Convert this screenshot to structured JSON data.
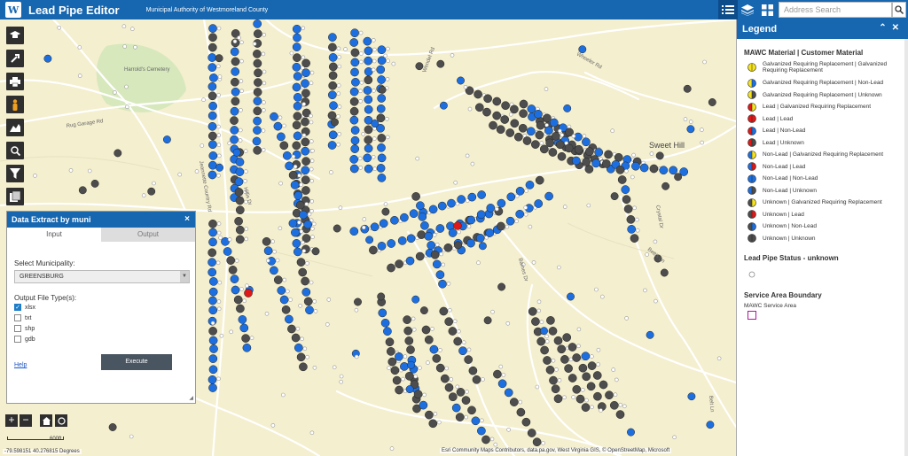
{
  "header": {
    "app_title": "Lead Pipe Editor",
    "org_name": "Municipal Authority of Westmoreland County",
    "logo_text": "W",
    "search_placeholder": "Address Search"
  },
  "map_labels": [
    {
      "text": "Harrold's Cemetery"
    },
    {
      "text": "Rug Garage Rd"
    },
    {
      "text": "Jeannette Country Rd"
    },
    {
      "text": "Hillis Dr"
    },
    {
      "text": "Wendel Rd"
    },
    {
      "text": "Guffey Rd"
    },
    {
      "text": "Wheeler Rd"
    },
    {
      "text": "Barnes Dr"
    },
    {
      "text": "Sweet Hill"
    },
    {
      "text": "Crystal Dr"
    },
    {
      "text": "Bettis Ln"
    },
    {
      "text": "Belt Ln"
    }
  ],
  "data_extract_panel": {
    "title": "Data Extract by muni",
    "close": "×",
    "tabs": [
      "Input",
      "Output"
    ],
    "select_label": "Select Municipality:",
    "selected_municipality": "GREENSBURG",
    "file_types_label": "Output File Type(s):",
    "file_types": [
      {
        "label": "xlsx",
        "checked": true
      },
      {
        "label": "txt",
        "checked": false
      },
      {
        "label": "shp",
        "checked": false
      },
      {
        "label": "gdb",
        "checked": false
      }
    ],
    "help_link": "Help",
    "execute_button": "Execute"
  },
  "map_controls": {
    "zoom_in": "+",
    "zoom_out": "−",
    "scale_label": "600ft",
    "coordinates": "-79.598151 40.276815 Degrees",
    "attribution": "Esri Community Maps Contributors, data.pa.gov, West Virginia GIS, © OpenStreetMap, Microsoft"
  },
  "legend": {
    "title": "Legend",
    "section1_title": "MAWC Material | Customer Material",
    "items": [
      {
        "label": "Galvanized Requiring Replacement | Galvanized Requiring Replacement",
        "left": "#f5e21a",
        "right": "#f5e21a"
      },
      {
        "label": "Galvanized Requiring Replacement | Non-Lead",
        "left": "#f5e21a",
        "right": "#1d6fe0"
      },
      {
        "label": "Galvanized Requiring Replacement | Unknown",
        "left": "#f5e21a",
        "right": "#4d4d4d"
      },
      {
        "label": "Lead | Galvanized Requiring Replacement",
        "left": "#e01818",
        "right": "#f5e21a"
      },
      {
        "label": "Lead | Lead",
        "left": "#e01818",
        "right": "#e01818"
      },
      {
        "label": "Lead | Non-Lead",
        "left": "#e01818",
        "right": "#1d6fe0"
      },
      {
        "label": "Lead | Unknown",
        "left": "#e01818",
        "right": "#4d4d4d"
      },
      {
        "label": "Non-Lead | Galvanized Requiring Replacement",
        "left": "#1d6fe0",
        "right": "#f5e21a"
      },
      {
        "label": "Non-Lead | Lead",
        "left": "#1d6fe0",
        "right": "#e01818"
      },
      {
        "label": "Non-Lead | Non-Lead",
        "left": "#1d6fe0",
        "right": "#1d6fe0"
      },
      {
        "label": "Non-Lead | Unknown",
        "left": "#1d6fe0",
        "right": "#4d4d4d"
      },
      {
        "label": "Unknown | Galvanized Requiring Replacement",
        "left": "#4d4d4d",
        "right": "#f5e21a"
      },
      {
        "label": "Unknown | Lead",
        "left": "#4d4d4d",
        "right": "#e01818"
      },
      {
        "label": "Unknown | Non-Lead",
        "left": "#4d4d4d",
        "right": "#1d6fe0"
      },
      {
        "label": "Unknown | Unknown",
        "left": "#4d4d4d",
        "right": "#4d4d4d"
      }
    ],
    "section2_title": "Lead Pipe Status - unknown",
    "section3_title": "Service Area Boundary",
    "service_area_label": "MAWC Service Area"
  },
  "colors": {
    "header": "#1666b0",
    "map_bg": "#f4efcf",
    "non_lead": "#1d6fe0",
    "unknown": "#4d4d4d",
    "lead": "#e01818",
    "service_area": "#b0169b"
  }
}
